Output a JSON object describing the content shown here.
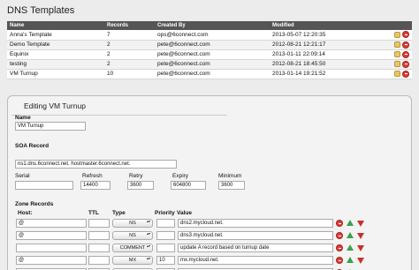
{
  "page_title": "DNS Templates",
  "templates_table": {
    "headers": [
      "Name",
      "Records",
      "Created By",
      "Modified"
    ],
    "rows": [
      {
        "name": "Anna's Template",
        "records": "7",
        "created_by": "ops@6connect.com",
        "modified": "2013-05-07 12:20:35"
      },
      {
        "name": "Demo Template",
        "records": "2",
        "created_by": "pete@6connect.com",
        "modified": "2012-08-21 12:21:17"
      },
      {
        "name": "Equinix",
        "records": "2",
        "created_by": "pete@6connect.com",
        "modified": "2013-01-11 22:09:14"
      },
      {
        "name": "testing",
        "records": "2",
        "created_by": "pete@6connect.com",
        "modified": "2012-08-21 18:45:50"
      },
      {
        "name": "VM Turnup",
        "records": "10",
        "created_by": "pete@6connect.com",
        "modified": "2013-01-14 19:21:52"
      }
    ]
  },
  "editor": {
    "title": "Editing VM Turnup",
    "name_label": "Name",
    "name_value": "VM Turnup",
    "soa_label": "SOA Record",
    "soa_value": "ns1.dns.6connect.net. hostmaster.6connect.net.",
    "serial_label": "Serial",
    "serial_value": "",
    "refresh_label": "Refresh",
    "refresh_value": "14400",
    "retry_label": "Retry",
    "retry_value": "3600",
    "expiry_label": "Expiry",
    "expiry_value": "604800",
    "minimum_label": "Minimum",
    "minimum_value": "3600",
    "zone_records_label": "Zone Records",
    "zone_headers": {
      "host": "Host:",
      "ttl": "TTL",
      "type": "Type",
      "priority": "Priority",
      "value": "Value"
    },
    "zone_rows": [
      {
        "host": "@",
        "ttl": "",
        "type": "NS",
        "priority": "",
        "value": "dns2.mycloud.net."
      },
      {
        "host": "@",
        "ttl": "",
        "type": "NS",
        "priority": "",
        "value": "dns3.mycloud.net."
      },
      {
        "host": "",
        "ttl": "",
        "type": "COMMENT",
        "priority": "",
        "value": "update A record based on turnup date"
      },
      {
        "host": "@",
        "ttl": "",
        "type": "MX",
        "priority": "10",
        "value": "mx.mycloud.net."
      },
      {
        "host": "",
        "ttl": "",
        "type": "",
        "priority": "",
        "value": ""
      }
    ]
  },
  "colors": {
    "header_bg": "#555555",
    "delete": "#d9413a",
    "up_arrow": "#3aa24a",
    "down_arrow": "#c9302c"
  }
}
